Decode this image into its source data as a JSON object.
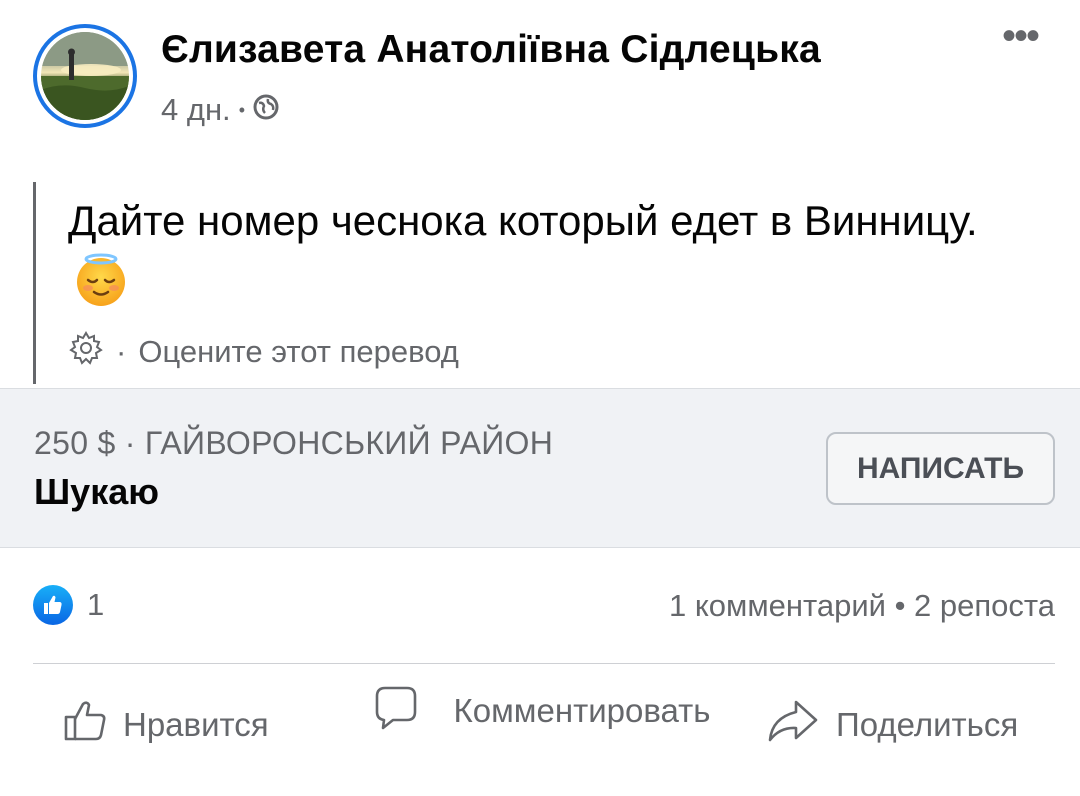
{
  "post": {
    "author": "Єлизавета Анатоліївна Сідлецька",
    "time": "4 дн.",
    "dot": "•",
    "privacy_icon": "globe-icon",
    "more_icon": "more-horizontal-icon",
    "more_label": "•••",
    "text": "Дайте номер чеснока который едет в Винницу.",
    "text_emoji": "relieved-face-emoji",
    "translate_icon": "gear-icon",
    "translate_dot": "·",
    "translate_label": "Оцените этот перевод"
  },
  "listing": {
    "meta": "250 $ · ГАЙВОРОНСЬКИЙ РАЙОН",
    "title": "Шукаю",
    "message_button": "НАПИСАТЬ"
  },
  "stats": {
    "like_count": "1",
    "summary": "1 комментарий • 2 репоста"
  },
  "actions": {
    "like": "Нравится",
    "comment": "Комментировать",
    "share": "Поделиться"
  },
  "colors": {
    "accent": "#1b74e4",
    "secondary_text": "#65676b",
    "listing_bg": "#f0f2f5"
  }
}
